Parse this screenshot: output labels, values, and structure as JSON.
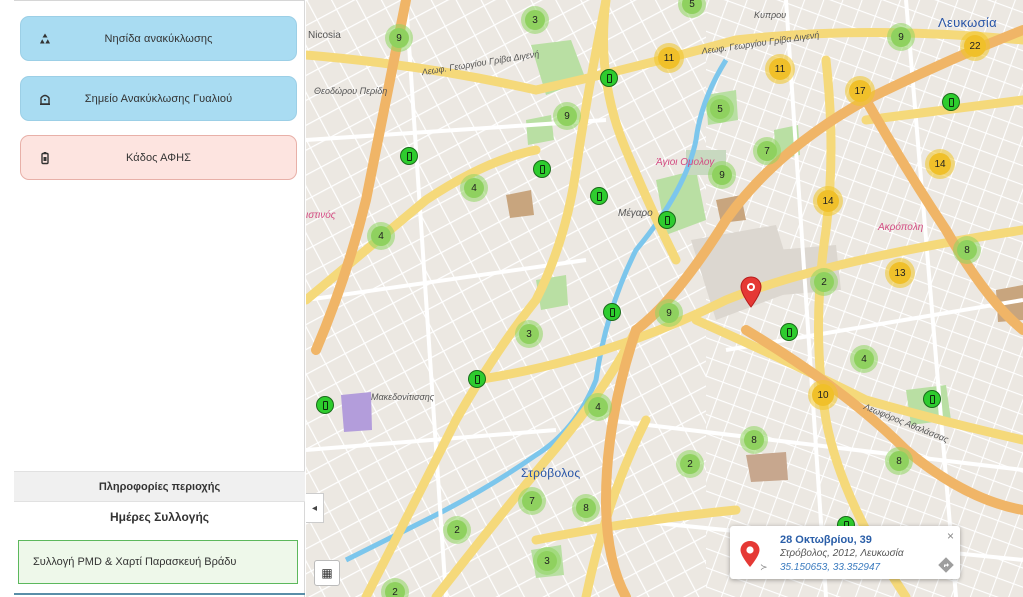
{
  "sidebar": {
    "categories": [
      {
        "label": "Νησίδα ανακύκλωσης",
        "icon": "recycle-icon",
        "style": "blue"
      },
      {
        "label": "Σημείο Ανακύκλωσης Γυαλιού",
        "icon": "glass-bin-icon",
        "style": "blue"
      },
      {
        "label": "Κάδος ΑΦΗΣ",
        "icon": "battery-bin-icon",
        "style": "pink"
      }
    ],
    "info_header": "Πληροφορίες περιοχής",
    "days_title": "Ημέρες Συλλογής",
    "schedule": "Συλλογή PMD & Χαρτί Παρασκευή Βράδυ"
  },
  "map": {
    "labels": {
      "lefkosia": "Λευκωσία",
      "strovolos": "Στρόβολος",
      "agioi_omologites": "Άγιοι Ομολογ",
      "akropoli": "Ακρόπολη",
      "agios_dometios": "ιστινός",
      "nicosia_label": "Nicosia",
      "megaro": "Μέγαρο",
      "street_1": "Λεωφ. Γεωργίου Γρίβα Διγενή",
      "street_2": "Λεωφ. Γεωργίου Γρίβα Διγενή",
      "street_3": "Λεωφόρος Αθαλάσσας",
      "street_4": "Μακεδονίτισσης",
      "street_5": "Θεοδώρου Περίδη",
      "street_6": "Κυπρου"
    },
    "clusters": [
      {
        "count": "3",
        "color": "green"
      },
      {
        "count": "9",
        "color": "green"
      },
      {
        "count": "5",
        "color": "green"
      },
      {
        "count": "11",
        "color": "yellow"
      },
      {
        "count": "11",
        "color": "yellow"
      },
      {
        "count": "9",
        "color": "green"
      },
      {
        "count": "22",
        "color": "yellow"
      },
      {
        "count": "9",
        "color": "green"
      },
      {
        "count": "17",
        "color": "yellow"
      },
      {
        "count": "5",
        "color": "green"
      },
      {
        "count": "7",
        "color": "green"
      },
      {
        "count": "9",
        "color": "green"
      },
      {
        "count": "14",
        "color": "yellow"
      },
      {
        "count": "4",
        "color": "green"
      },
      {
        "count": "14",
        "color": "yellow"
      },
      {
        "count": "4",
        "color": "green"
      },
      {
        "count": "8",
        "color": "green"
      },
      {
        "count": "2",
        "color": "green"
      },
      {
        "count": "13",
        "color": "yellow"
      },
      {
        "count": "9",
        "color": "green"
      },
      {
        "count": "3",
        "color": "green"
      },
      {
        "count": "4",
        "color": "green"
      },
      {
        "count": "10",
        "color": "yellow"
      },
      {
        "count": "4",
        "color": "green"
      },
      {
        "count": "8",
        "color": "green"
      },
      {
        "count": "2",
        "color": "green"
      },
      {
        "count": "8",
        "color": "green"
      },
      {
        "count": "7",
        "color": "green"
      },
      {
        "count": "8",
        "color": "green"
      },
      {
        "count": "2",
        "color": "green"
      },
      {
        "count": "3",
        "color": "green"
      },
      {
        "count": "2",
        "color": "green"
      }
    ],
    "popup": {
      "title": "28 Οκτωβρίου, 39",
      "address": "Στρόβολος, 2012, Λευκωσία",
      "coords": "35.150653, 33.352947",
      "close": "×"
    },
    "collapse_glyph": "◂",
    "layers_glyph": "▦"
  }
}
